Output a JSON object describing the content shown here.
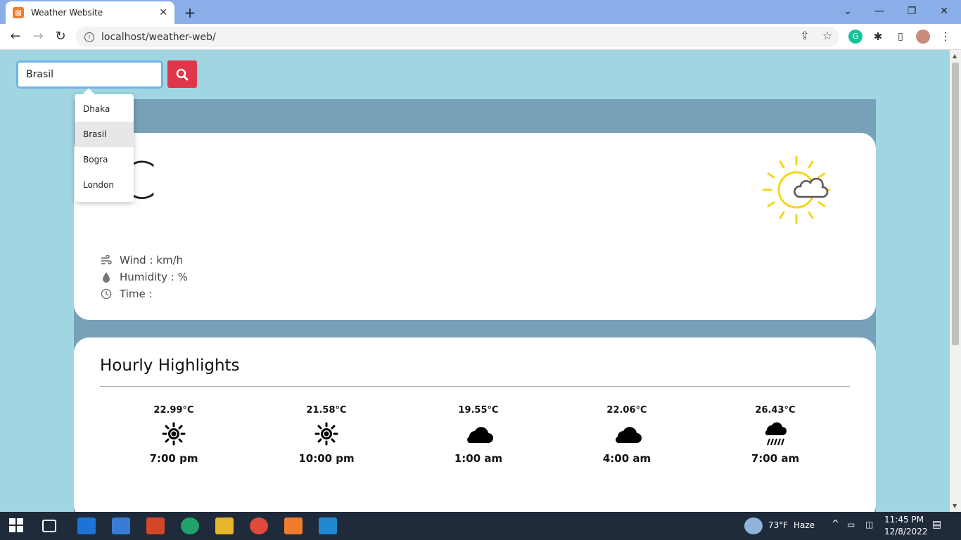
{
  "browser": {
    "tab_title": "Weather Website",
    "url": "localhost/weather-web/"
  },
  "search": {
    "value": "Brasil",
    "suggestions": [
      "Dhaka",
      "Brasil",
      "Bogra",
      "London"
    ],
    "highlighted": "Brasil"
  },
  "current": {
    "temp_unit_glyph": "C",
    "wind_label": "Wind : km/h",
    "humidity_label": "Humidity : %",
    "time_label": "Time :",
    "weather_icon": "sun-cloud-icon"
  },
  "hourly": {
    "title": "Hourly Highlights",
    "items": [
      {
        "temp": "22.99°C",
        "icon": "sun-icon",
        "time": "7:00 pm"
      },
      {
        "temp": "21.58°C",
        "icon": "sun-icon",
        "time": "10:00 pm"
      },
      {
        "temp": "19.55°C",
        "icon": "cloud-icon",
        "time": "1:00 am"
      },
      {
        "temp": "22.06°C",
        "icon": "cloud-icon",
        "time": "4:00 am"
      },
      {
        "temp": "26.43°C",
        "icon": "rain-icon",
        "time": "7:00 am"
      }
    ]
  },
  "taskbar": {
    "weather": "73°F",
    "condition": "Haze",
    "time": "11:45 PM",
    "date": "12/8/2022"
  },
  "colors": {
    "accent_red": "#e0364b",
    "panel": "#77a1b8",
    "background": "#a0d6e2"
  }
}
